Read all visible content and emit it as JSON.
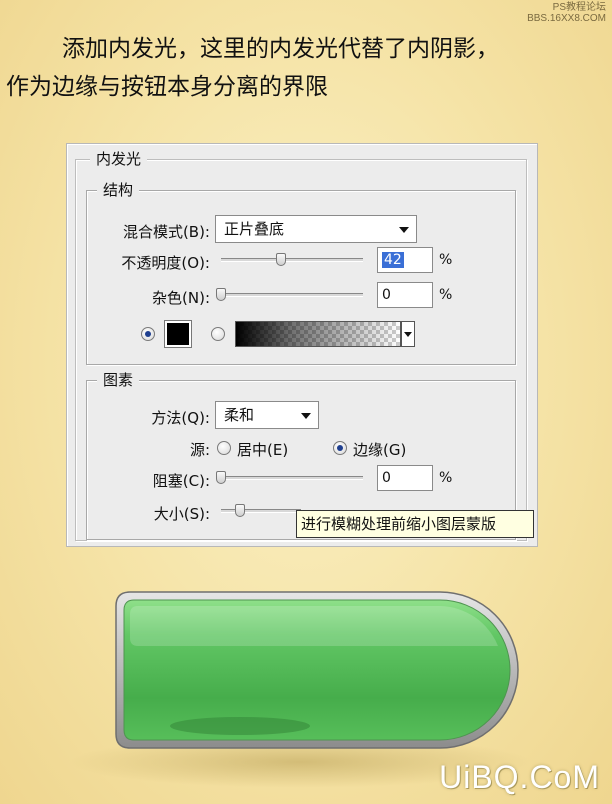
{
  "watermark_top": {
    "line1": "PS教程论坛",
    "line2": "BBS.16XX8.COM"
  },
  "headline": {
    "line1": "添加内发光，这里的内发光代替了内阴影，",
    "line2": "作为边缘与按钮本身分离的界限"
  },
  "dialog": {
    "title": "内发光",
    "structure": {
      "title": "结构",
      "blend_mode_label": "混合模式(B):",
      "blend_mode_value": "正片叠底",
      "opacity_label": "不透明度(O):",
      "opacity_value": "42",
      "opacity_level": 0.42,
      "noise_label": "杂色(N):",
      "noise_value": "0",
      "noise_level": 0,
      "percent": "%",
      "glow_color": "#000000",
      "color_mode": "solid"
    },
    "elements": {
      "title": "图素",
      "method_label": "方法(Q):",
      "method_value": "柔和",
      "source_label": "源:",
      "source_center_label": "居中(E)",
      "source_edge_label": "边缘(G)",
      "source_selected": "edge",
      "choke_label": "阻塞(C):",
      "choke_value": "0",
      "choke_level": 0,
      "size_label": "大小(S):",
      "percent": "%"
    },
    "tooltip": "进行模糊处理前缩小图层蒙版"
  },
  "button_preview": {
    "fill_color": "#5cc45c",
    "edge_color": "#9a9a9a"
  },
  "watermark_bottom": "UiBQ.CoM"
}
